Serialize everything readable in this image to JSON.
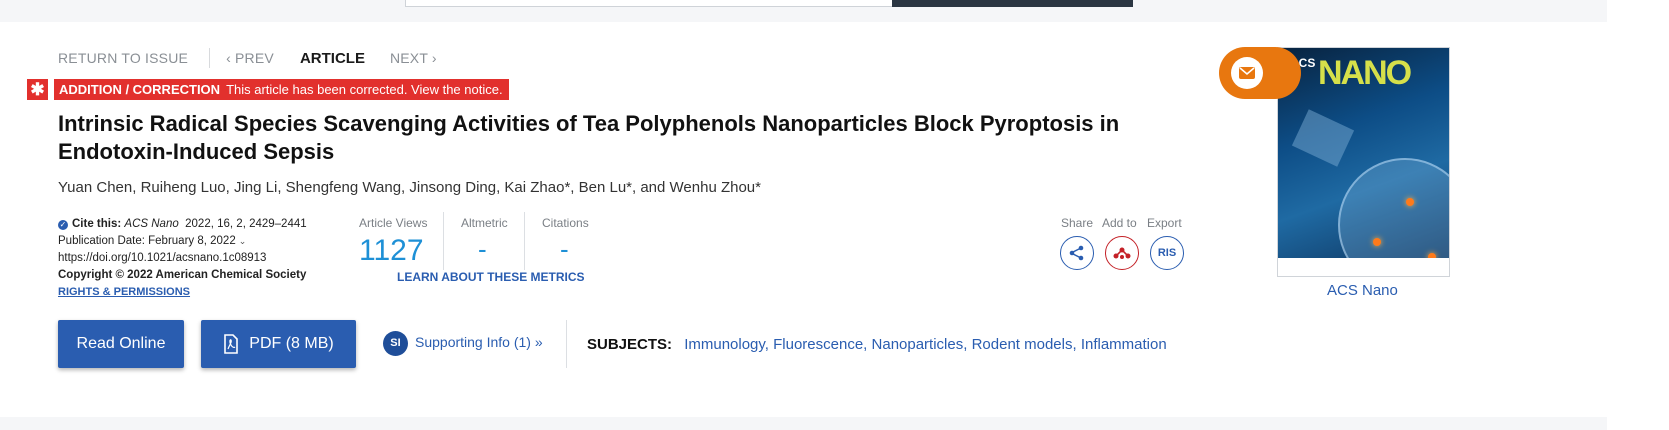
{
  "nav": {
    "return_to_issue": "RETURN TO ISSUE",
    "prev": "PREV",
    "current": "ARTICLE",
    "next": "NEXT"
  },
  "correction": {
    "badge": "✱",
    "title": "ADDITION / CORRECTION",
    "message": "This article has been corrected. View the notice."
  },
  "article": {
    "title": "Intrinsic Radical Species Scavenging Activities of Tea Polyphenols Nanoparticles Block Pyroptosis in Endotoxin-Induced Sepsis",
    "authors": "Yuan Chen, Ruiheng Luo, Jing Li, Shengfeng Wang, Jinsong Ding, Kai Zhao*, Ben Lu*, and Wenhu Zhou*"
  },
  "citation": {
    "cite_label": "Cite this:",
    "journal": "ACS Nano",
    "ref": "2022, 16, 2, 2429–2441",
    "pub_date": "Publication Date: February 8, 2022",
    "doi": "https://doi.org/10.1021/acsnano.1c08913",
    "copyright": "Copyright © 2022 American Chemical Society",
    "rights": "RIGHTS & PERMISSIONS"
  },
  "metrics": {
    "views_label": "Article Views",
    "views_value": "1127",
    "altmetric_label": "Altmetric",
    "altmetric_value": "-",
    "citations_label": "Citations",
    "citations_value": "-",
    "learn_more": "LEARN ABOUT THESE METRICS"
  },
  "tools": {
    "share_label": "Share",
    "add_label": "Add to",
    "export_label": "Export",
    "export_button": "RIS"
  },
  "actions": {
    "read_online": "Read Online",
    "pdf": "PDF (8 MB)",
    "si_badge": "SI",
    "supporting_info": "Supporting Info (1) »"
  },
  "subjects": {
    "header": "SUBJECTS:",
    "items": [
      "Immunology,",
      "Fluorescence,",
      "Nanoparticles,",
      "Rodent models,",
      "Inflammation"
    ]
  },
  "cover": {
    "logo": "NANO",
    "logo_prefix": "ACS",
    "link": "ACS Nano"
  },
  "colors": {
    "accent_blue": "#2a5db0",
    "metric_blue": "#1e90d6",
    "correction_red": "#e2302d",
    "email_orange": "#e8770f"
  },
  "icons": {
    "email": "envelope-icon",
    "share": "share-icon",
    "mendeley": "mendeley-icon",
    "pdf": "pdf-file-icon",
    "check": "check-circle-icon",
    "chevron": "chevron-down-icon"
  }
}
